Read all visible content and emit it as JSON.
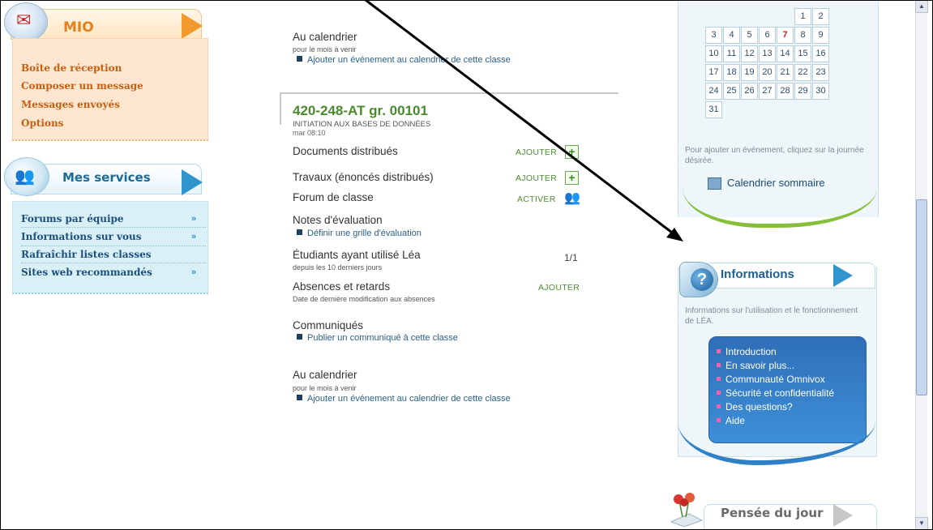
{
  "mio": {
    "title": "MIO",
    "items": [
      "Boîte de réception",
      "Composer un message",
      "Messages envoyés",
      "Options"
    ]
  },
  "services": {
    "title": "Mes services",
    "items": [
      "Forums par équipe",
      "Informations sur vous",
      "Rafraîchir listes classes",
      "Sites web recommandés"
    ],
    "arrow": "»"
  },
  "top_calendar": {
    "heading": "Au calendrier",
    "sub": "pour le mois à venir",
    "link": "Ajouter un événement au calendrier de cette classe"
  },
  "course": {
    "code": "420-248-AT gr. 00101",
    "name": "INITIATION AUX BASES DE DONNÉES",
    "time": "mar 08:10",
    "sections": {
      "documents": {
        "label": "Documents distribués",
        "action": "AJOUTER"
      },
      "travaux": {
        "label": "Travaux (énoncés distribués)",
        "action": "AJOUTER"
      },
      "forum": {
        "label": "Forum de classe",
        "action": "ACTIVER"
      },
      "notes": {
        "label": "Notes d'évaluation",
        "link": "Définir une grille d'évaluation"
      },
      "etudiants": {
        "label": "Étudiants ayant utilisé Léa",
        "sub": "depuis les 10 derniers jours",
        "ratio": "1/1"
      },
      "absences": {
        "label": "Absences et retards",
        "sub": "Date de dernière modification aux absences",
        "action": "AJOUTER"
      },
      "communiques": {
        "label": "Communiqués",
        "link": "Publier un communiqué à cette classe"
      },
      "calendrier": {
        "label": "Au calendrier",
        "sub": "pour le mois à venir",
        "link": "Ajouter un événement au calendrier de cette classe"
      }
    }
  },
  "calendar": {
    "days": [
      "1",
      "2",
      "3",
      "4",
      "5",
      "6",
      "7",
      "8",
      "9",
      "10",
      "11",
      "12",
      "13",
      "14",
      "15",
      "16",
      "17",
      "18",
      "19",
      "20",
      "21",
      "22",
      "23",
      "24",
      "25",
      "26",
      "27",
      "28",
      "29",
      "30",
      "31"
    ],
    "today": "7",
    "note": "Pour ajouter un événement, cliquez sur la journée désirée.",
    "summary_link": "Calendrier sommaire"
  },
  "informations": {
    "title": "Informations",
    "desc": "Informations sur l'utilisation et le fonctionnement de LÉA.",
    "links": [
      "Introduction",
      "En savoir plus...",
      "Communauté Omnivox",
      "Sécurité et confidentialité",
      "Des questions?",
      "Aide"
    ]
  },
  "pensee": {
    "title": "Pensée du jour"
  },
  "colors": {
    "mio_accent": "#e0801f",
    "services_accent": "#1e6a96",
    "course_green": "#4a8a2d",
    "info_blue": "#2f6fb7"
  }
}
